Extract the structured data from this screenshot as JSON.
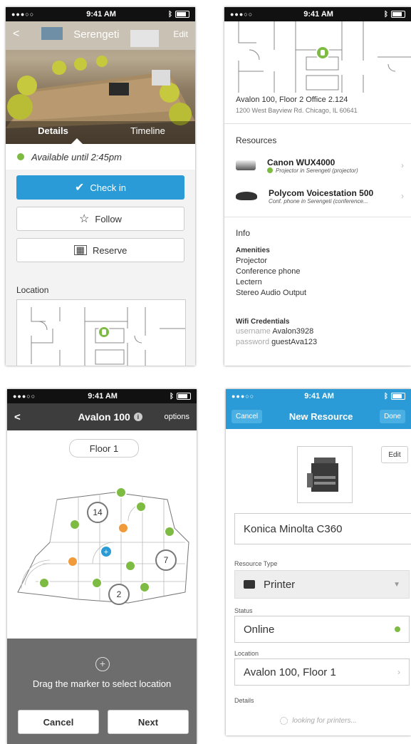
{
  "status": {
    "time": "9:41 AM",
    "signal": "●●●○○",
    "wifi": "wifi-icon",
    "bluetooth": "bluetooth-icon"
  },
  "colors": {
    "accent": "#2a9bd6",
    "available": "#7dbb42",
    "dark_header": "#3d3d3d",
    "orange": "#f09a3a"
  },
  "screen1": {
    "room_name": "Serengeti",
    "edit_label": "Edit",
    "tabs": [
      "Details",
      "Timeline"
    ],
    "availability": "Available until 2:45pm",
    "check_in_label": "Check in",
    "follow_label": "Follow",
    "reserve_label": "Reserve",
    "location_label": "Location"
  },
  "screen2": {
    "address_line1": "Avalon 100, Floor 2  Office 2.124",
    "address_line2": "1200 West Bayview Rd. Chicago, IL 60641",
    "resources_header": "Resources",
    "resources": [
      {
        "name": "Canon WUX4000",
        "detail": "Projector in Serengeti (projector)",
        "icon": "projector-icon",
        "status": "available"
      },
      {
        "name": "Polycom Voicestation 500",
        "detail": "Conf. phone in Serengeti (conference...",
        "icon": "conference-phone-icon",
        "status": ""
      }
    ],
    "info_header": "Info",
    "amenities_header": "Amenities",
    "amenities": [
      "Projector",
      "Conference phone",
      "Lectern",
      "Stereo Audio Output"
    ],
    "wifi_header": "Wifi Credentials",
    "username_label": "username",
    "username_value": "Avalon3928",
    "password_label": "password",
    "password_value": "guestAva123"
  },
  "screen3": {
    "back": "<",
    "title": "Avalon 100",
    "options_label": "options",
    "floor_label": "Floor 1",
    "cluster_counts": [
      "14",
      "7",
      "2"
    ],
    "drag_hint": "Drag the marker to select location",
    "cancel_label": "Cancel",
    "next_label": "Next"
  },
  "screen4": {
    "cancel_label": "Cancel",
    "title": "New Resource",
    "done_label": "Done",
    "edit_label": "Edit",
    "name_value": "Konica Minolta C360",
    "resource_type_label": "Resource Type",
    "resource_type_value": "Printer",
    "status_label": "Status",
    "status_value": "Online",
    "location_label": "Location",
    "location_value": "Avalon 100, Floor 1",
    "details_label": "Details",
    "details_loading": "looking for printers..."
  }
}
